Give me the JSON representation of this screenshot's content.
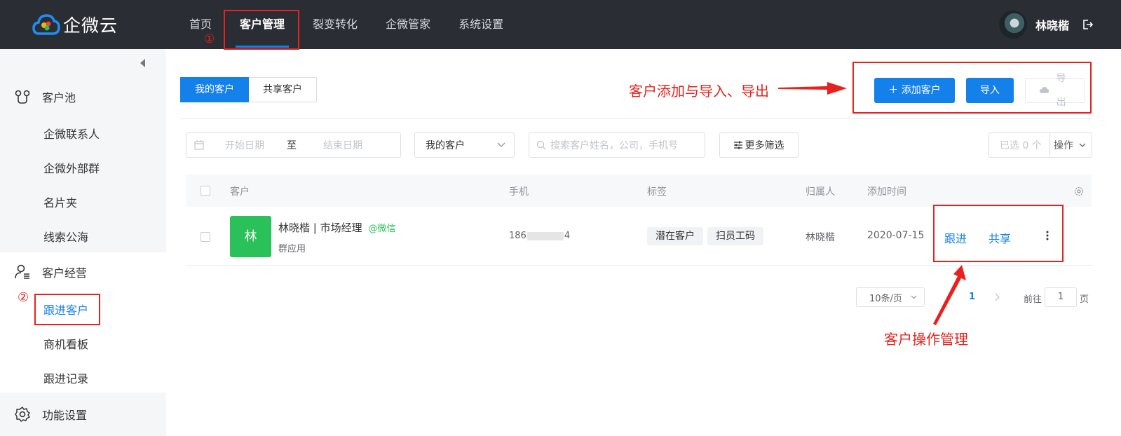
{
  "header": {
    "app_name": "企微云",
    "nav": [
      {
        "label": "首页"
      },
      {
        "label": "客户管理"
      },
      {
        "label": "裂变转化"
      },
      {
        "label": "企微管家"
      },
      {
        "label": "系统设置"
      }
    ],
    "user_name": "林晓楷"
  },
  "sidebar": {
    "groups": [
      {
        "label": "客户池",
        "items": [
          {
            "label": "企微联系人"
          },
          {
            "label": "企微外部群"
          },
          {
            "label": "名片夹"
          },
          {
            "label": "线索公海"
          }
        ]
      },
      {
        "label": "客户经营",
        "items": [
          {
            "label": "跟进客户"
          },
          {
            "label": "商机看板"
          },
          {
            "label": "跟进记录"
          }
        ]
      },
      {
        "label": "功能设置",
        "items": []
      }
    ]
  },
  "tabs": [
    {
      "label": "我的客户"
    },
    {
      "label": "共享客户"
    }
  ],
  "actions": {
    "add": "＋ 添加客户",
    "import": "导入",
    "export": "导出"
  },
  "filters": {
    "start_date": "开始日期",
    "to": "至",
    "end_date": "结束日期",
    "scope": "我的客户",
    "search_placeholder": "搜索客户姓名，公司，手机号",
    "more": "更多筛选",
    "selected": "已选 0 个",
    "ops": "操作"
  },
  "table": {
    "columns": [
      "客户",
      "手机",
      "标签",
      "归属人",
      "添加时间"
    ],
    "rows": [
      {
        "avatar": "林",
        "name": "林晓楷 | 市场经理",
        "source": "@微信",
        "sub": "群应用",
        "phone_prefix": "186",
        "phone_suffix": "4",
        "tags": [
          "潜在客户",
          "扫员工码"
        ],
        "owner": "林晓楷",
        "added": "2020-07-15",
        "actions": [
          "跟进",
          "共享"
        ]
      }
    ]
  },
  "pagination": {
    "size": "10条/页",
    "current": "1",
    "goto_prefix": "前往",
    "goto_value": "1",
    "goto_suffix": "页"
  },
  "annotations": {
    "marker1": "①",
    "marker2": "②",
    "note_top": "客户添加与导入、导出",
    "note_bottom": "客户操作管理"
  },
  "colors": {
    "topbar": "#2b2d35",
    "primary": "#1480ea",
    "annotation": "#e8211c",
    "avatar_green": "#2bc15a"
  }
}
